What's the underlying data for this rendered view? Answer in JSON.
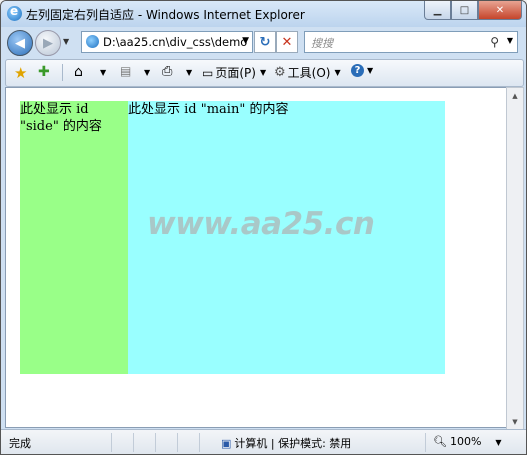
{
  "window": {
    "title": "左列固定右列自适应 - Windows Internet Explorer",
    "minimize": "▁",
    "maximize": "□",
    "close": "✕"
  },
  "nav": {
    "address": "D:\\aa25.cn\\div_css\\demo",
    "search_placeholder": "搜搜"
  },
  "commandbar": {
    "page_label": "页面(P)",
    "tools_label": "工具(O)"
  },
  "page": {
    "side_text": "此处显示  id \"side\" 的内容",
    "main_text": "此处显示  id \"main\" 的内容",
    "watermark": "www.aa25.cn",
    "colors": {
      "side": "#99ff88",
      "main": "#99ffff"
    }
  },
  "status": {
    "text": "完成",
    "zone": "计算机 | 保护模式: 禁用",
    "zoom": "100%"
  }
}
